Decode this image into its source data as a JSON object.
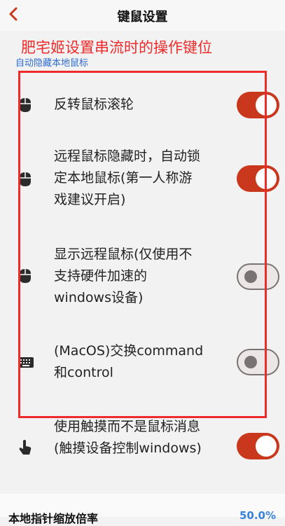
{
  "header": {
    "title": "键鼠设置"
  },
  "annotation": {
    "text": "肥宅姬设置串流时的操作键位",
    "color": "#ee2b2b"
  },
  "section": {
    "label": "自动隐藏本地鼠标"
  },
  "settings": [
    {
      "label": "反转鼠标滚轮",
      "icon": "mouse-icon",
      "enabled": true
    },
    {
      "label": "远程鼠标隐藏时，自动锁定本地鼠标(第一人称游戏建议开启)",
      "icon": "mouse-icon",
      "enabled": true
    },
    {
      "label": "显示远程鼠标(仅使用不支持硬件加速的windows设备)",
      "icon": "mouse-icon",
      "enabled": false
    },
    {
      "label": "(MacOS)交换command和control",
      "icon": "keyboard-icon",
      "enabled": false
    },
    {
      "label": "使用触摸而不是鼠标消息(触摸设备控制windows)",
      "icon": "touch-icon",
      "enabled": true
    }
  ],
  "footer": {
    "label": "本地指针缩放倍率",
    "value": "50.0%"
  },
  "colors": {
    "accent": "#c9381c",
    "link": "#2d6cd2",
    "annotation": "#ee2b2b"
  }
}
